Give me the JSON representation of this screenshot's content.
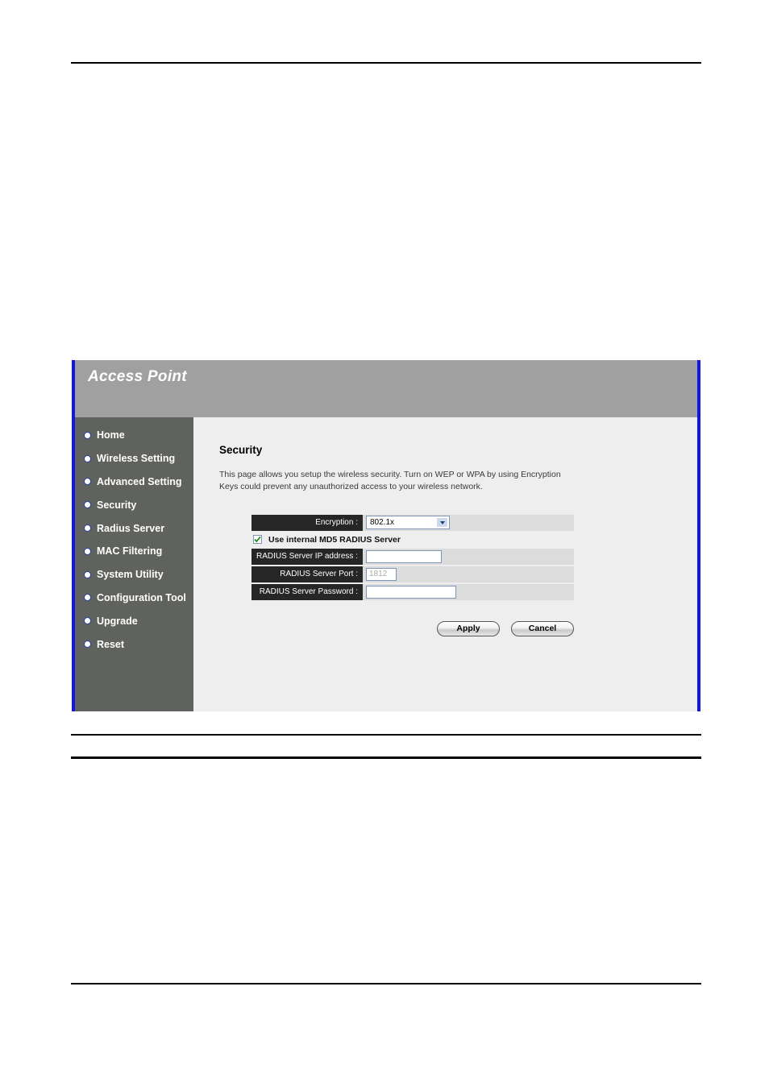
{
  "panel": {
    "header_title": "Access Point",
    "sidebar": {
      "items": [
        {
          "label": "Home"
        },
        {
          "label": "Wireless Setting"
        },
        {
          "label": "Advanced Setting"
        },
        {
          "label": "Security"
        },
        {
          "label": "Radius Server"
        },
        {
          "label": "MAC Filtering"
        },
        {
          "label": "System Utility"
        },
        {
          "label": "Configuration Tool"
        },
        {
          "label": "Upgrade"
        },
        {
          "label": "Reset"
        }
      ]
    },
    "content": {
      "title": "Security",
      "description": "This page allows you setup the wireless security. Turn on WEP or WPA by using Encryption Keys could prevent any unauthorized access to your wireless network.",
      "form": {
        "encryption_label": "Encryption :",
        "encryption_value": "802.1x",
        "internal_md5_label": "Use internal MD5 RADIUS Server",
        "internal_md5_checked": true,
        "radius_ip_label": "RADIUS Server IP address :",
        "radius_ip_value": "",
        "radius_port_label": "RADIUS Server Port :",
        "radius_port_value": "1812",
        "radius_password_label": "RADIUS Server Password :",
        "radius_password_value": ""
      },
      "buttons": {
        "apply": "Apply",
        "cancel": "Cancel"
      }
    }
  },
  "colors": {
    "panel_border": "#1414e6",
    "header_bg": "#a0a0a0",
    "sidebar_bg": "#60625e",
    "content_bg": "#eeeeee",
    "label_bg": "#262626",
    "row_bg": "#dcdcdc",
    "check_mark": "#108010"
  }
}
